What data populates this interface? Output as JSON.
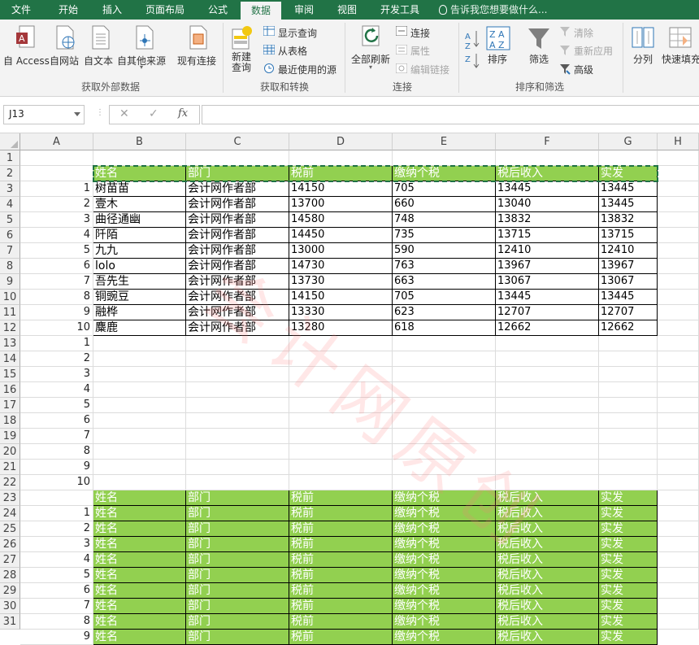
{
  "tabs": [
    "文件",
    "开始",
    "插入",
    "页面布局",
    "公式",
    "数据",
    "审阅",
    "视图",
    "开发工具"
  ],
  "active_tab": "数据",
  "tell_me": "告诉我您想要做什么...",
  "ribbon": {
    "get_external": {
      "access": "自 Access",
      "web": "自网站",
      "text": "自文本",
      "other": "自其他来源",
      "existing": "现有连接",
      "group": "获取外部数据"
    },
    "get_transform": {
      "new_query": "新建\n查询",
      "new_query_l1": "新建",
      "new_query_l2": "查询",
      "show_query": "显示查询",
      "from_table": "从表格",
      "recent": "最近使用的源",
      "group": "获取和转换"
    },
    "connections": {
      "refresh_all": "全部刷新",
      "connections": "连接",
      "properties": "属性",
      "edit_links": "编辑链接",
      "group": "连接"
    },
    "sort_filter": {
      "sort": "排序",
      "filter": "筛选",
      "clear": "清除",
      "reapply": "重新应用",
      "advanced": "高级",
      "group": "排序和筛选"
    },
    "data_tools": {
      "split": "分列",
      "flash_fill": "快速填充"
    }
  },
  "formula_bar": {
    "name_box": "J13",
    "fx": "fx",
    "value": ""
  },
  "columns": [
    "A",
    "B",
    "C",
    "D",
    "E",
    "F",
    "G",
    "H"
  ],
  "rows": [
    "1",
    "2",
    "3",
    "4",
    "5",
    "6",
    "7",
    "8",
    "9",
    "10",
    "11",
    "12",
    "13",
    "14",
    "15",
    "16",
    "17",
    "18",
    "19",
    "20",
    "21",
    "22",
    "23",
    "24",
    "25",
    "26",
    "27",
    "28",
    "29",
    "30",
    "31"
  ],
  "header_row": [
    "姓名",
    "部门",
    "税前",
    "缴纳个税",
    "税后收入",
    "实发"
  ],
  "records": [
    {
      "idx": "1",
      "name": "树苗苗",
      "dept": "会计网作者部",
      "pretax": "14150",
      "tax": "705",
      "after": "13445",
      "paid": "13445"
    },
    {
      "idx": "2",
      "name": "壹木",
      "dept": "会计网作者部",
      "pretax": "13700",
      "tax": "660",
      "after": "13040",
      "paid": "13445"
    },
    {
      "idx": "3",
      "name": "曲径通幽",
      "dept": "会计网作者部",
      "pretax": "14580",
      "tax": "748",
      "after": "13832",
      "paid": "13832"
    },
    {
      "idx": "4",
      "name": "阡陌",
      "dept": "会计网作者部",
      "pretax": "14450",
      "tax": "735",
      "after": "13715",
      "paid": "13715"
    },
    {
      "idx": "5",
      "name": "九九",
      "dept": "会计网作者部",
      "pretax": "13000",
      "tax": "590",
      "after": "12410",
      "paid": "12410"
    },
    {
      "idx": "6",
      "name": "lolo",
      "dept": "会计网作者部",
      "pretax": "14730",
      "tax": "763",
      "after": "13967",
      "paid": "13967"
    },
    {
      "idx": "7",
      "name": "吾先生",
      "dept": "会计网作者部",
      "pretax": "13730",
      "tax": "663",
      "after": "13067",
      "paid": "13067"
    },
    {
      "idx": "8",
      "name": "铜豌豆",
      "dept": "会计网作者部",
      "pretax": "14150",
      "tax": "705",
      "after": "13445",
      "paid": "13445"
    },
    {
      "idx": "9",
      "name": "融桦",
      "dept": "会计网作者部",
      "pretax": "13330",
      "tax": "623",
      "after": "12707",
      "paid": "12707"
    },
    {
      "idx": "10",
      "name": "麋鹿",
      "dept": "会计网作者部",
      "pretax": "13280",
      "tax": "618",
      "after": "12662",
      "paid": "12662"
    }
  ],
  "helper_numbers_a": [
    "1",
    "2",
    "3",
    "4",
    "5",
    "6",
    "7",
    "8",
    "9",
    "10"
  ],
  "header_copies_idx": [
    "",
    "1",
    "2",
    "3",
    "4",
    "5",
    "6",
    "7",
    "8",
    "9"
  ],
  "watermark": "会计网原创"
}
